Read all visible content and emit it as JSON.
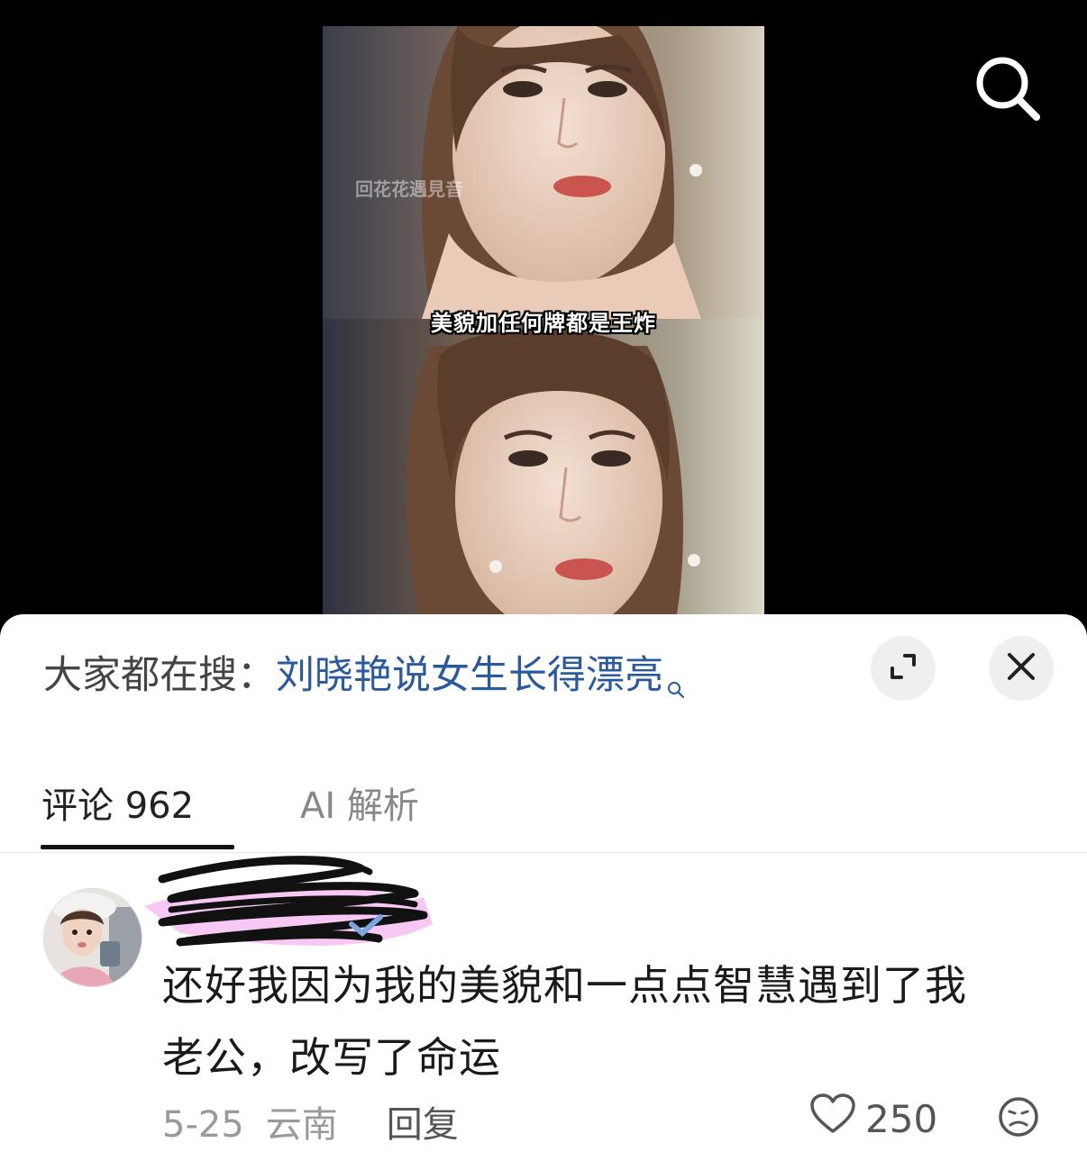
{
  "video": {
    "caption": "美貌加任何牌都是王炸",
    "watermark": "回花花遇見音"
  },
  "icons": {
    "search": "search-icon",
    "expand": "expand-icon",
    "close": "close-icon",
    "search_small": "search-small-icon",
    "heart": "heart-icon",
    "emoji": "sad-face-icon"
  },
  "hot_search": {
    "label": "大家都在搜：",
    "term": "刘晓艳说女生长得漂亮"
  },
  "tabs": {
    "comments_label": "评论 962",
    "ai_label": "AI 解析"
  },
  "comment": {
    "text_line1": "还好我因为我的美貌和一点点智慧遇到了我",
    "text_line2": "老公，改写了命运",
    "date": "5-25",
    "location": "云南",
    "reply": "回复",
    "likes": "250"
  },
  "colors": {
    "link": "#2a5a9b",
    "accent_scribble_black": "#111111",
    "accent_scribble_pink": "#f3b6ef"
  }
}
